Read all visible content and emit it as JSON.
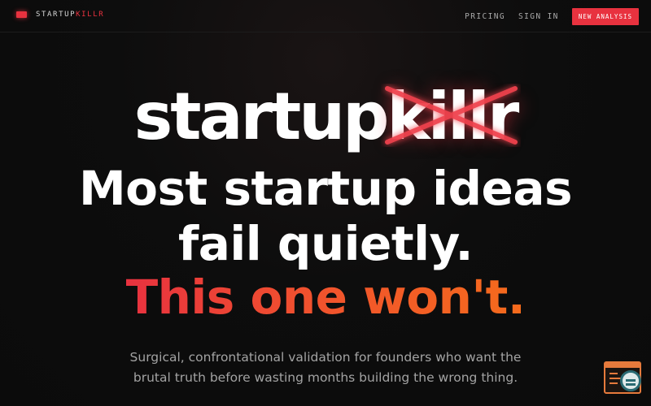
{
  "header": {
    "brand_part1": "STARTUP",
    "brand_part2": "KILLR",
    "nav": {
      "pricing": "PRICING",
      "sign_in": "SIGN IN",
      "cta": "NEW ANALYSIS"
    }
  },
  "hero": {
    "logo_part1": "startup",
    "logo_part2": "killr",
    "headline": {
      "line1": "Most startup ideas",
      "line2": "fail quietly.",
      "line3": "This one won't."
    },
    "subtitle": {
      "line1": "Surgical, confrontational validation for founders who want the",
      "line2": "brutal truth before wasting months building the wrong thing."
    }
  },
  "colors": {
    "accent": "#e8323f",
    "accent_orange": "#f56b1c",
    "background": "#0b0b0b"
  },
  "icons": {
    "brand_mark": "brand-mark-icon",
    "floating_widget": "inspect-window-icon"
  }
}
